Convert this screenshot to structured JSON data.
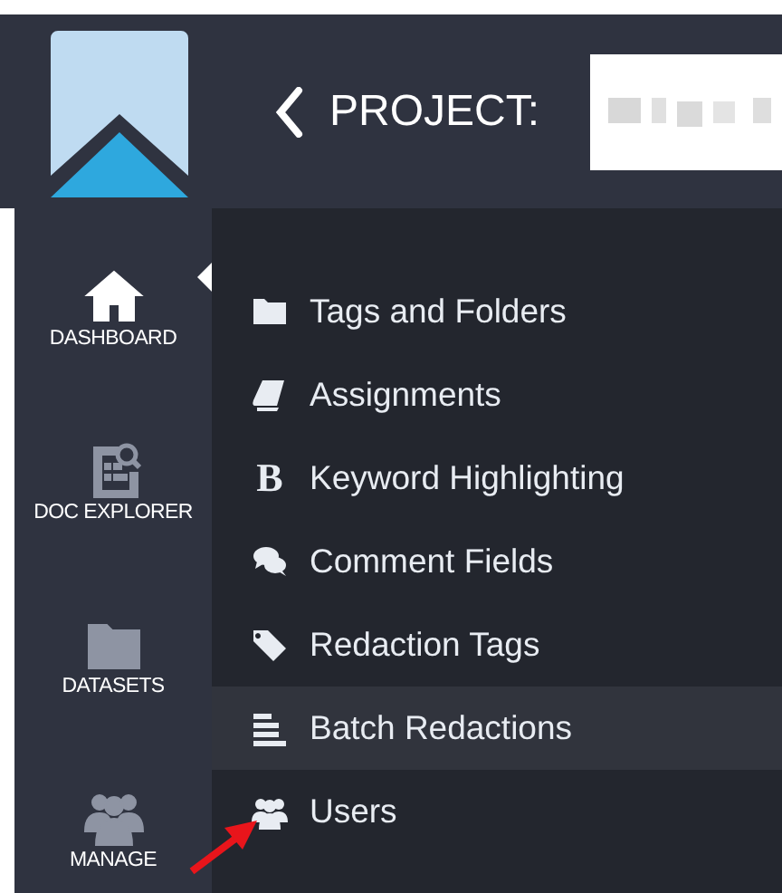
{
  "header": {
    "title": "PROJECT:"
  },
  "sidebar": {
    "items": [
      {
        "label": "DASHBOARD",
        "selected": true
      },
      {
        "label": "DOC EXPLORER",
        "selected": false
      },
      {
        "label": "DATASETS",
        "selected": false
      },
      {
        "label": "MANAGE",
        "selected": false
      }
    ]
  },
  "menu": {
    "items": [
      {
        "label": "Tags and Folders",
        "selected": false
      },
      {
        "label": "Assignments",
        "selected": false
      },
      {
        "label": "Keyword Highlighting",
        "selected": false,
        "icon": "B"
      },
      {
        "label": "Comment Fields",
        "selected": false
      },
      {
        "label": "Redaction Tags",
        "selected": false
      },
      {
        "label": "Batch Redactions",
        "selected": true
      },
      {
        "label": "Users",
        "selected": false
      }
    ]
  }
}
